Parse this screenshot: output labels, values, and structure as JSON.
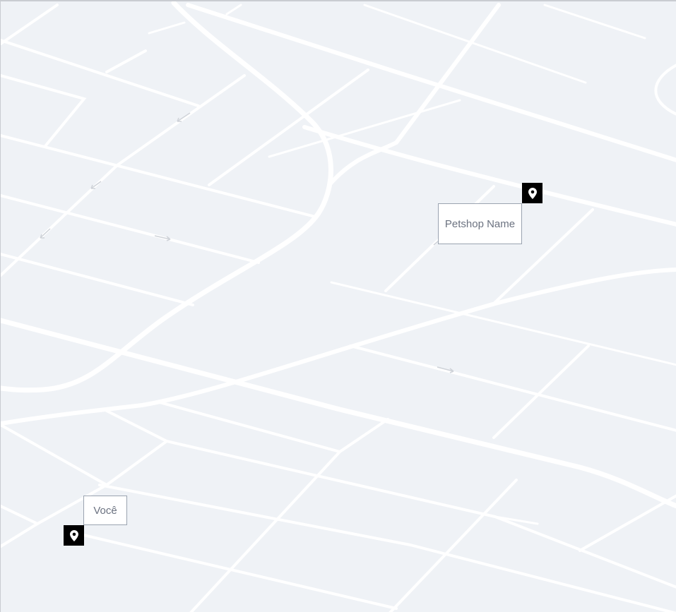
{
  "map": {
    "background_color": "#eff2f6",
    "road_color": "#ffffff",
    "markers": [
      {
        "id": "petshop",
        "label": "Petshop Name",
        "icon": "map-pin-icon"
      },
      {
        "id": "user",
        "label": "Você",
        "icon": "map-pin-icon"
      }
    ]
  }
}
